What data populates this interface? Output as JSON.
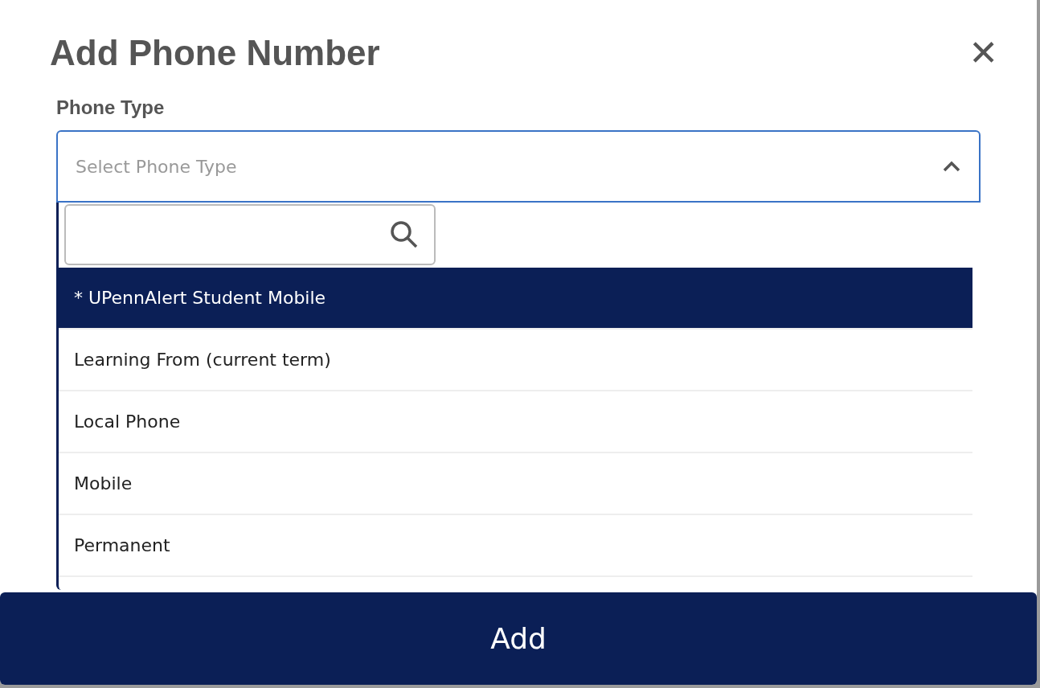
{
  "dialog": {
    "title": "Add Phone Number",
    "close_label": "✕"
  },
  "phone_type": {
    "label": "Phone Type",
    "placeholder": "Select Phone Type",
    "expanded": true,
    "options": [
      {
        "label": "* UPennAlert Student Mobile",
        "selected": true
      },
      {
        "label": "Learning From (current term)",
        "selected": false
      },
      {
        "label": "Local Phone",
        "selected": false
      },
      {
        "label": "Mobile",
        "selected": false
      },
      {
        "label": "Permanent",
        "selected": false
      }
    ]
  },
  "submit": {
    "label": "Add"
  }
}
